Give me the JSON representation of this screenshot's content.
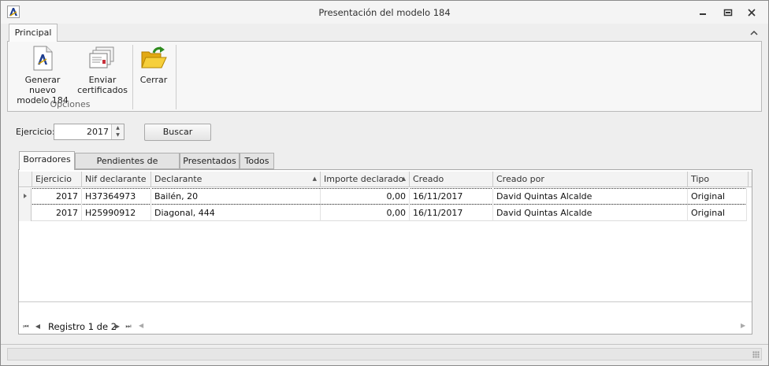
{
  "window": {
    "title": "Presentación del modelo 184"
  },
  "ribbon": {
    "tab_label": "Principal",
    "buttons": [
      {
        "label": "Generar nuevo\nmodelo 184",
        "icon": "document-aeat-icon"
      },
      {
        "label": "Enviar\ncertificados",
        "icon": "certificates-icon"
      },
      {
        "label": "Cerrar",
        "icon": "open-folder-icon"
      }
    ],
    "group_label": "Opciones"
  },
  "filter": {
    "ejercicio_label": "Ejercicio:",
    "ejercicio_value": "2017",
    "buscar_label": "Buscar"
  },
  "tabs": [
    {
      "label": "Borradores",
      "active": true
    },
    {
      "label": "Pendientes de presentar",
      "active": false
    },
    {
      "label": "Presentados",
      "active": false
    },
    {
      "label": "Todos",
      "active": false
    }
  ],
  "grid": {
    "columns": [
      {
        "label": "Ejercicio"
      },
      {
        "label": "Nif declarante"
      },
      {
        "label": "Declarante",
        "sort": "▲"
      },
      {
        "label": "Importe declarado",
        "sort": "▲"
      },
      {
        "label": "Creado"
      },
      {
        "label": "Creado por"
      },
      {
        "label": "Tipo"
      }
    ],
    "rows": [
      [
        "2017",
        "H37364973",
        "Bailén, 20",
        "0,00",
        "16/11/2017",
        "David Quintas Alcalde",
        "Original"
      ],
      [
        "2017",
        "H25990912",
        "Diagonal, 444",
        "0,00",
        "16/11/2017",
        "David Quintas Alcalde",
        "Original"
      ]
    ],
    "selected_row": 0,
    "navigator_text": "Registro 1 de 2"
  },
  "colors": {
    "ribbon_bg": "#f7f7f7",
    "window_bg": "#eeeeee",
    "accent_green": "#2e8b1e",
    "folder_yellow": "#f2c21a"
  }
}
